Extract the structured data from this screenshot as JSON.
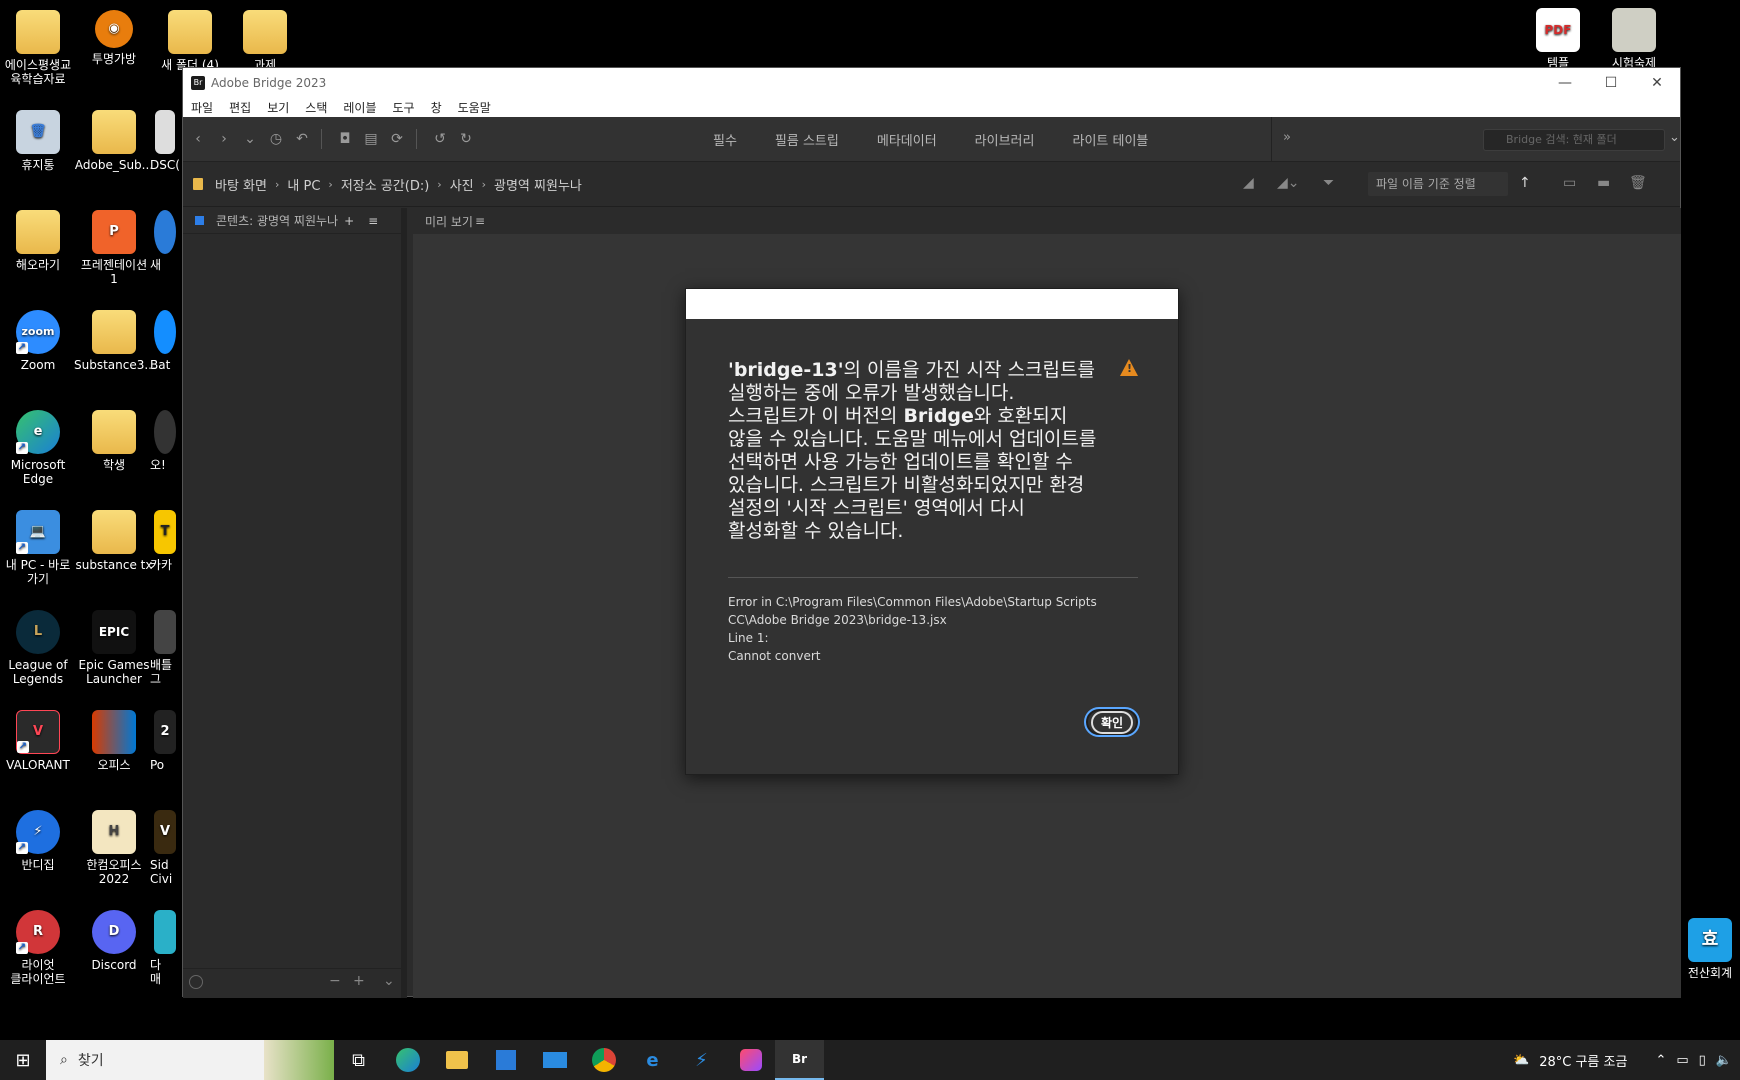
{
  "desktop": {
    "icons": [
      {
        "label": "에이스평생교\n육학습자료",
        "glyph": "📁"
      },
      {
        "label": "투명가방",
        "glyph": "◉"
      },
      {
        "label": "새 폴더 (4)",
        "glyph": ""
      },
      {
        "label": "과제",
        "glyph": ""
      },
      {
        "label": "휴지통",
        "glyph": "🗑"
      },
      {
        "label": "Adobe_Sub...",
        "glyph": ""
      },
      {
        "label": "DSC(",
        "glyph": ""
      },
      {
        "label": "해오라기",
        "glyph": ""
      },
      {
        "label": "프레젠테이션\n1",
        "glyph": "P"
      },
      {
        "label": "새",
        "glyph": ""
      },
      {
        "label": "Zoom",
        "glyph": "zoom"
      },
      {
        "label": "Substance3...",
        "glyph": ""
      },
      {
        "label": "Bat",
        "glyph": ""
      },
      {
        "label": "Microsoft\nEdge",
        "glyph": "e"
      },
      {
        "label": "학생",
        "glyph": ""
      },
      {
        "label": "오!",
        "glyph": ""
      },
      {
        "label": "내 PC - 바로\n가기",
        "glyph": "💻"
      },
      {
        "label": "substance tx",
        "glyph": ""
      },
      {
        "label": "카카",
        "glyph": "T"
      },
      {
        "label": "League of\nLegends",
        "glyph": "L"
      },
      {
        "label": "Epic Games\nLauncher",
        "glyph": "EPIC"
      },
      {
        "label": "배틀그",
        "glyph": ""
      },
      {
        "label": "VALORANT",
        "glyph": "V"
      },
      {
        "label": "오피스",
        "glyph": ""
      },
      {
        "label": "Po",
        "glyph": "2"
      },
      {
        "label": "반디집",
        "glyph": "⚡"
      },
      {
        "label": "한컴오피스\n2022",
        "glyph": "H"
      },
      {
        "label": "Sid\nCivi",
        "glyph": "V"
      },
      {
        "label": "라이엇\n클라이언트",
        "glyph": "R"
      },
      {
        "label": "Discord",
        "glyph": "D"
      },
      {
        "label": "다\n매",
        "glyph": ""
      },
      {
        "label": "템플",
        "glyph": "PDF"
      },
      {
        "label": "시험숙제",
        "glyph": ""
      },
      {
        "label": "전산회계",
        "glyph": "효"
      }
    ]
  },
  "window": {
    "logo": "Br",
    "title": "Adobe Bridge 2023",
    "controls": [
      "—",
      "☐",
      "✕"
    ]
  },
  "menu": [
    "파일",
    "편집",
    "보기",
    "스택",
    "레이블",
    "도구",
    "창",
    "도움말"
  ],
  "workspaces": [
    "필수",
    "필름 스트립",
    "메타데이터",
    "라이브러리",
    "라이트 테이블"
  ],
  "workspace_more": "»",
  "search_placeholder": "Bridge 검색: 현재 폴더",
  "path": [
    "바탕 화면",
    "내 PC",
    "저장소 공간(D:)",
    "사진",
    "광명역 찌원누나"
  ],
  "sort": "파일 이름 기준 정렬",
  "panels": {
    "content_tab": "콘텐츠: 광명역 찌원누나",
    "preview_tab": "미리 보기"
  },
  "dialog": {
    "message_bold1": "'bridge-13'",
    "message_1": "의 이름을 가진 시작 스크립트를 실행하는 중에 오류가 발생했습니다. 스크립트가 이 버전의 ",
    "message_bold2": "Bridge",
    "message_2": "와 호환되지 않을 수 있습니다. 도움말 메뉴에서 업데이트를 선택하면 사용 가능한 업데이트를 확인할 수 있습니다. 스크립트가 비활성화되었지만 환경 설정의 '시작 스크립트' 영역에서 다시 활성화할 수 있습니다.",
    "error_line1": "Error in C:\\Program Files\\Common Files\\Adobe\\Startup Scripts CC\\Adobe Bridge 2023\\bridge-13.jsx",
    "error_line2": "Line 1:",
    "error_line3": "Cannot convert",
    "ok_label": "확인"
  },
  "taskbar": {
    "search_placeholder": "찾기",
    "weather": "28°C 구름 조금",
    "apps": [
      "task-view",
      "edge",
      "explorer",
      "store",
      "mail",
      "chrome",
      "ie",
      "bandizip",
      "creative-cloud",
      "bridge"
    ]
  }
}
